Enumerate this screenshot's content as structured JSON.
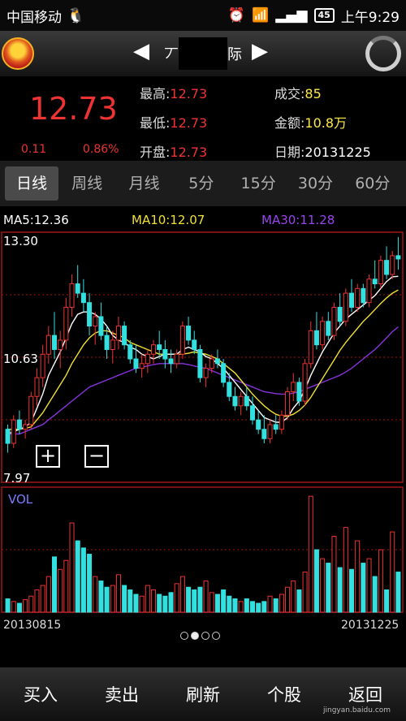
{
  "status": {
    "carrier": "中国移动",
    "battery": "45",
    "time": "上午9:29"
  },
  "header": {
    "title_fragment_left": "丆",
    "title_fragment_right": "际"
  },
  "quote": {
    "price": "12.73",
    "change": "0.11",
    "change_pct": "0.86%",
    "high_label": "最高:",
    "high": "12.73",
    "low_label": "最低:",
    "low": "12.73",
    "open_label": "开盘:",
    "open": "12.73",
    "volume_label": "成交:",
    "volume": "85",
    "amount_label": "金额:",
    "amount": "10.8万",
    "date_label": "日期:",
    "date": "20131225"
  },
  "tabs": [
    "日线",
    "周线",
    "月线",
    "5分",
    "15分",
    "30分",
    "60分"
  ],
  "ma": {
    "ma5": "MA5:12.36",
    "ma10": "MA10:12.07",
    "ma30": "MA30:11.28"
  },
  "colors": {
    "up": "#ee3333",
    "down": "#33e0e0",
    "ma5": "#ffffff",
    "ma10": "#f0e030",
    "ma30": "#8833dd",
    "grid": "#a01818"
  },
  "chart_data": {
    "type": "candlestick",
    "ylim": [
      7.97,
      13.3
    ],
    "y_ticks": [
      "13.30",
      "10.63",
      "7.97"
    ],
    "vol_label": "VOL",
    "x_start": "20130815",
    "x_end": "20131225",
    "ohlc": [
      [
        9.1,
        9.2,
        8.6,
        8.8
      ],
      [
        8.8,
        9.4,
        8.7,
        9.3
      ],
      [
        9.3,
        9.5,
        9.0,
        9.1
      ],
      [
        9.1,
        9.3,
        8.9,
        9.2
      ],
      [
        9.2,
        9.9,
        9.1,
        9.8
      ],
      [
        9.8,
        10.4,
        9.6,
        10.2
      ],
      [
        10.2,
        10.9,
        10.0,
        10.7
      ],
      [
        10.7,
        11.3,
        10.5,
        11.1
      ],
      [
        11.1,
        11.6,
        10.6,
        10.8
      ],
      [
        10.8,
        11.2,
        10.4,
        11.0
      ],
      [
        11.0,
        11.9,
        10.8,
        11.7
      ],
      [
        11.7,
        12.4,
        11.5,
        12.2
      ],
      [
        12.2,
        12.6,
        11.9,
        12.0
      ],
      [
        12.0,
        12.3,
        11.6,
        11.8
      ],
      [
        11.8,
        12.0,
        11.1,
        11.3
      ],
      [
        11.3,
        11.6,
        10.9,
        11.5
      ],
      [
        11.5,
        11.8,
        11.0,
        11.1
      ],
      [
        11.1,
        11.3,
        10.6,
        10.8
      ],
      [
        10.8,
        11.2,
        10.5,
        11.0
      ],
      [
        11.0,
        11.5,
        10.8,
        11.3
      ],
      [
        11.3,
        11.4,
        10.8,
        10.9
      ],
      [
        10.9,
        11.0,
        10.5,
        10.6
      ],
      [
        10.6,
        10.9,
        10.3,
        10.4
      ],
      [
        10.4,
        10.7,
        10.2,
        10.5
      ],
      [
        10.5,
        10.8,
        10.3,
        10.7
      ],
      [
        10.7,
        11.0,
        10.5,
        10.9
      ],
      [
        10.9,
        11.2,
        10.6,
        10.8
      ],
      [
        10.8,
        11.0,
        10.4,
        10.6
      ],
      [
        10.6,
        10.8,
        10.3,
        10.5
      ],
      [
        10.5,
        10.8,
        10.4,
        10.7
      ],
      [
        10.7,
        11.4,
        10.6,
        11.3
      ],
      [
        11.3,
        11.5,
        10.9,
        11.0
      ],
      [
        11.0,
        11.2,
        10.7,
        10.8
      ],
      [
        10.8,
        10.9,
        10.1,
        10.2
      ],
      [
        10.2,
        10.5,
        10.0,
        10.4
      ],
      [
        10.4,
        10.7,
        10.3,
        10.6
      ],
      [
        10.6,
        10.8,
        10.4,
        10.5
      ],
      [
        10.5,
        10.6,
        10.0,
        10.1
      ],
      [
        10.1,
        10.3,
        9.7,
        9.8
      ],
      [
        9.8,
        10.0,
        9.5,
        9.6
      ],
      [
        9.6,
        9.9,
        9.4,
        9.8
      ],
      [
        9.8,
        10.0,
        9.5,
        9.6
      ],
      [
        9.6,
        9.8,
        9.2,
        9.3
      ],
      [
        9.3,
        9.5,
        9.0,
        9.1
      ],
      [
        9.1,
        9.4,
        8.8,
        8.9
      ],
      [
        8.9,
        9.3,
        8.8,
        9.2
      ],
      [
        9.2,
        9.4,
        9.0,
        9.1
      ],
      [
        9.1,
        9.5,
        9.0,
        9.4
      ],
      [
        9.4,
        10.0,
        9.3,
        9.9
      ],
      [
        9.9,
        10.3,
        9.7,
        10.1
      ],
      [
        10.1,
        10.2,
        9.6,
        9.7
      ],
      [
        9.7,
        10.6,
        9.6,
        10.5
      ],
      [
        10.5,
        11.4,
        10.4,
        11.2
      ],
      [
        11.2,
        11.6,
        10.8,
        10.9
      ],
      [
        10.9,
        11.5,
        10.8,
        11.4
      ],
      [
        11.4,
        11.6,
        11.0,
        11.1
      ],
      [
        11.1,
        11.8,
        11.0,
        11.7
      ],
      [
        11.7,
        12.0,
        11.3,
        11.4
      ],
      [
        11.4,
        12.1,
        11.3,
        12.0
      ],
      [
        12.0,
        12.3,
        11.6,
        11.7
      ],
      [
        11.7,
        12.2,
        11.6,
        12.1
      ],
      [
        12.1,
        12.2,
        11.7,
        11.8
      ],
      [
        11.8,
        12.4,
        11.7,
        12.3
      ],
      [
        12.3,
        12.7,
        12.1,
        12.2
      ],
      [
        12.2,
        12.8,
        12.1,
        12.7
      ],
      [
        12.7,
        13.0,
        12.3,
        12.4
      ],
      [
        12.4,
        12.9,
        12.3,
        12.8
      ],
      [
        12.8,
        13.2,
        12.5,
        12.73
      ]
    ],
    "ma5": [
      9.0,
      9.05,
      9.1,
      9.15,
      9.25,
      9.55,
      9.85,
      10.25,
      10.5,
      10.75,
      11.05,
      11.35,
      11.55,
      11.6,
      11.6,
      11.55,
      11.45,
      11.3,
      11.1,
      11.0,
      10.95,
      10.85,
      10.8,
      10.7,
      10.65,
      10.6,
      10.65,
      10.7,
      10.7,
      10.7,
      10.8,
      10.85,
      10.8,
      10.75,
      10.65,
      10.6,
      10.5,
      10.4,
      10.25,
      10.1,
      9.95,
      9.8,
      9.65,
      9.5,
      9.35,
      9.3,
      9.25,
      9.25,
      9.35,
      9.55,
      9.7,
      9.95,
      10.25,
      10.5,
      10.75,
      10.95,
      11.15,
      11.3,
      11.45,
      11.55,
      11.65,
      11.75,
      11.85,
      11.95,
      12.1,
      12.25,
      12.35,
      12.36
    ],
    "ma10": [
      9.1,
      9.1,
      9.1,
      9.12,
      9.15,
      9.3,
      9.45,
      9.65,
      9.85,
      10.05,
      10.25,
      10.5,
      10.7,
      10.9,
      11.05,
      11.15,
      11.2,
      11.2,
      11.15,
      11.1,
      11.05,
      10.95,
      10.9,
      10.85,
      10.8,
      10.75,
      10.7,
      10.7,
      10.7,
      10.7,
      10.7,
      10.72,
      10.75,
      10.72,
      10.7,
      10.65,
      10.6,
      10.5,
      10.4,
      10.3,
      10.15,
      10.0,
      9.85,
      9.72,
      9.6,
      9.5,
      9.42,
      9.38,
      9.38,
      9.42,
      9.5,
      9.62,
      9.78,
      9.98,
      10.18,
      10.38,
      10.58,
      10.78,
      10.95,
      11.1,
      11.25,
      11.4,
      11.52,
      11.65,
      11.78,
      11.9,
      12.0,
      12.07
    ],
    "ma30": [
      9.0,
      9.0,
      9.0,
      9.05,
      9.1,
      9.15,
      9.2,
      9.3,
      9.4,
      9.5,
      9.6,
      9.7,
      9.8,
      9.9,
      10.0,
      10.05,
      10.1,
      10.15,
      10.2,
      10.25,
      10.3,
      10.35,
      10.4,
      10.42,
      10.45,
      10.48,
      10.5,
      10.5,
      10.5,
      10.5,
      10.5,
      10.48,
      10.45,
      10.42,
      10.4,
      10.35,
      10.3,
      10.25,
      10.2,
      10.15,
      10.1,
      10.05,
      10.0,
      9.95,
      9.9,
      9.88,
      9.86,
      9.85,
      9.85,
      9.87,
      9.9,
      9.95,
      10.0,
      10.05,
      10.1,
      10.15,
      10.2,
      10.25,
      10.32,
      10.4,
      10.5,
      10.6,
      10.7,
      10.8,
      10.92,
      11.05,
      11.18,
      11.28
    ],
    "volume": [
      15,
      12,
      10,
      14,
      18,
      25,
      30,
      40,
      62,
      48,
      58,
      100,
      80,
      72,
      65,
      40,
      35,
      28,
      30,
      42,
      30,
      25,
      20,
      18,
      30,
      25,
      20,
      18,
      22,
      32,
      40,
      28,
      25,
      28,
      35,
      22,
      20,
      25,
      18,
      15,
      12,
      15,
      12,
      10,
      12,
      18,
      15,
      20,
      28,
      35,
      25,
      45,
      130,
      70,
      60,
      55,
      85,
      50,
      95,
      48,
      80,
      55,
      60,
      40,
      70,
      25,
      90,
      45
    ]
  },
  "page_dots": 4,
  "active_dot": 1,
  "bottom": [
    "买入",
    "卖出",
    "刷新",
    "个股",
    "返回"
  ],
  "watermark": "jingyan.baidu.com"
}
